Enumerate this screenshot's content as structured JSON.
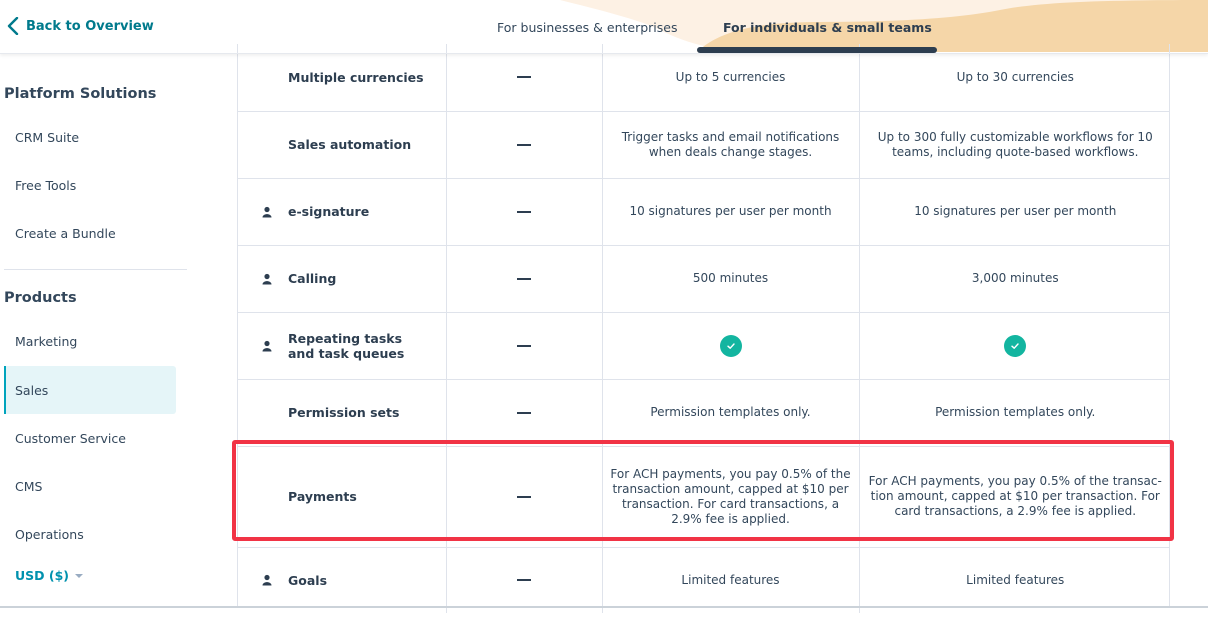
{
  "header": {
    "back_label": "Back to Overview",
    "tabs": [
      {
        "label": "For businesses & enterprises",
        "active": false
      },
      {
        "label": "For individuals & small teams",
        "active": true
      }
    ]
  },
  "sidebar": {
    "platform_heading": "Platform Solutions",
    "platform_items": [
      {
        "label": "CRM Suite"
      },
      {
        "label": "Free Tools"
      },
      {
        "label": "Create a Bundle"
      }
    ],
    "products_heading": "Products",
    "product_items": [
      {
        "label": "Marketing",
        "active": false
      },
      {
        "label": "Sales",
        "active": true
      },
      {
        "label": "Customer Service",
        "active": false
      },
      {
        "label": "CMS",
        "active": false
      },
      {
        "label": "Operations",
        "active": false
      }
    ],
    "currency": "USD ($)"
  },
  "table": {
    "rows": [
      {
        "feature": "Multiple currencies",
        "user_icon": false,
        "free": "dash",
        "starter": "Up to 5 currencies",
        "pro": "Up to 30 currencies"
      },
      {
        "feature": "Sales automation",
        "user_icon": false,
        "free": "dash",
        "starter": "Trigger tasks and email notifications when deals change stages.",
        "pro": "Up to 300 fully customizable workflows for 10 teams, including quote-based workflows."
      },
      {
        "feature": "e-signature",
        "user_icon": true,
        "free": "dash",
        "starter": "10 signatures per user per month",
        "pro": "10 signatures per user per month"
      },
      {
        "feature": "Calling",
        "user_icon": true,
        "free": "dash",
        "starter": "500 minutes",
        "pro": "3,000 minutes"
      },
      {
        "feature": "Repeating tasks and task queues",
        "user_icon": true,
        "free": "dash",
        "starter": "check",
        "pro": "check"
      },
      {
        "feature": "Permission sets",
        "user_icon": false,
        "free": "dash",
        "starter": "Permission templates only.",
        "pro": "Permission templates only."
      },
      {
        "feature": "Payments",
        "user_icon": false,
        "free": "dash",
        "starter": "For ACH payments, you pay 0.5% of the transaction amount, capped at $10 per transaction. For card transactions, a 2.9% fee is applied.",
        "pro": "For ACH payments, you pay 0.5% of the transac-tion amount, capped at $10 per transaction. For card transactions, a 2.9% fee is applied."
      },
      {
        "feature": "Goals",
        "user_icon": true,
        "free": "dash",
        "starter": "Limited features",
        "pro": "Limited features"
      }
    ],
    "highlighted_row": "Payments"
  },
  "colors": {
    "accent": "#00a4bd",
    "link": "#007a8c",
    "check": "#13b5a0",
    "highlight": "#f13345",
    "tab_bg": "#f5d6a8"
  }
}
